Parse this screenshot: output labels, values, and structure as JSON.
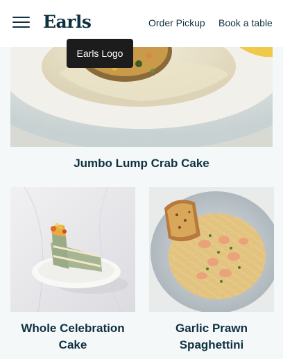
{
  "header": {
    "logo_text": "Earls",
    "nav": {
      "order_pickup": "Order Pickup",
      "book_table": "Book a table"
    }
  },
  "tooltip": {
    "text": "Earls Logo"
  },
  "menu_items": {
    "crab_cake": {
      "title": "Jumbo Lump Crab Cake"
    },
    "celebration_cake": {
      "title": "Whole Celebration Cake"
    },
    "prawn_spaghettini": {
      "title": "Garlic Prawn Spaghettini"
    }
  },
  "colors": {
    "brand_navy": "#0f3040",
    "page_background": "#f4f8f9",
    "tooltip_background": "#1c1c1c"
  },
  "icons": {
    "menu": "hamburger-menu-icon"
  }
}
